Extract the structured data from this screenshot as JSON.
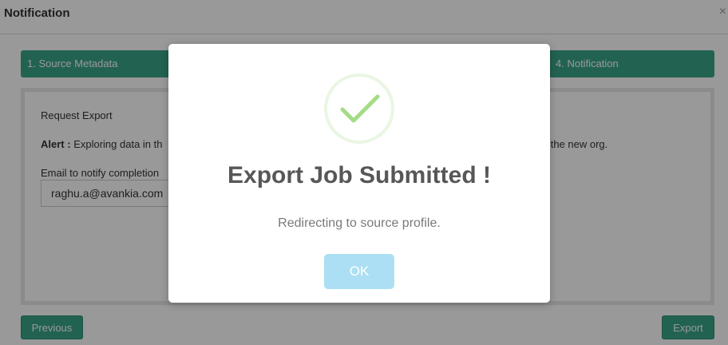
{
  "header": {
    "title": "Notification",
    "close_symbol": "×"
  },
  "steps": {
    "step1": "1. Source Metadata",
    "step4": "4. Notification"
  },
  "panel": {
    "heading": "Request Export",
    "alert_label": "Alert :",
    "alert_text_visible": "Exploring data in th",
    "alert_text_tail": "in the new org.",
    "email_label": "Email to notify completion",
    "email_value": "raghu.a@avankia.com"
  },
  "buttons": {
    "previous": "Previous",
    "export": "Export"
  },
  "modal": {
    "title": "Export Job Submitted !",
    "text": "Redirecting to source profile.",
    "ok": "OK",
    "icon": "checkmark-icon"
  },
  "colors": {
    "accent_green": "#3aa488",
    "overlay": "rgba(0,0,0,0.4)",
    "ok_button": "#acdff3",
    "check_green": "#a5dc86"
  }
}
